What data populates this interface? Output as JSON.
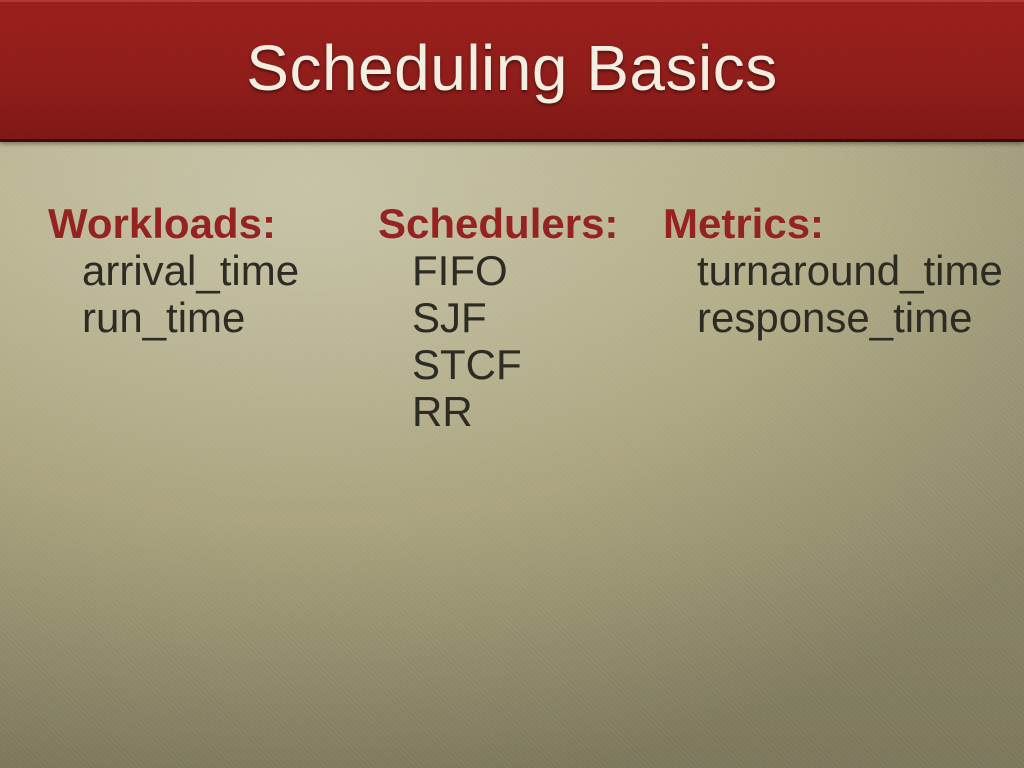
{
  "title": "Scheduling Basics",
  "columns": {
    "workloads": {
      "heading": "Workloads:",
      "items": [
        "arrival_time",
        "run_time"
      ]
    },
    "schedulers": {
      "heading": "Schedulers:",
      "items": [
        "FIFO",
        "SJF",
        "STCF",
        "RR"
      ]
    },
    "metrics": {
      "heading": "Metrics:",
      "items": [
        "turnaround_time",
        "response_time"
      ]
    }
  }
}
